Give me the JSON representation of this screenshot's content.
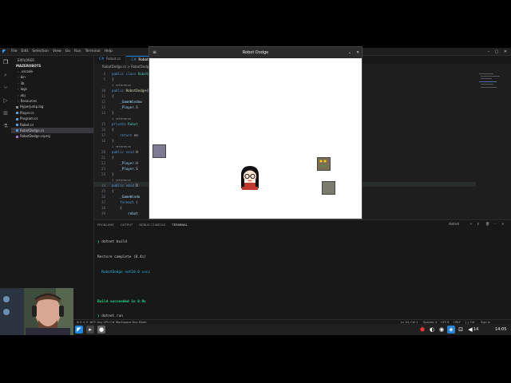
{
  "titlebar": {
    "menu": [
      "File",
      "Edit",
      "Selection",
      "View",
      "Go",
      "Run",
      "Terminal",
      "Help"
    ],
    "search": "MazeRobots",
    "update_label": "Update"
  },
  "explorer": {
    "header": "EXPLORER",
    "root": "MAZEROBOTS",
    "folders": [
      ".vscode",
      "bin",
      "lib",
      "logs",
      "obj",
      "Resources"
    ],
    "files": [
      "Hyperjump.log",
      "Player.cs",
      "Program.cs",
      "Robot.cs",
      "RobotDodge.cs",
      "RobotDodge.csproj"
    ],
    "active_file": "RobotDodge.cs",
    "outline_label": "OUTLINE",
    "timeline_label": "TIMELINE"
  },
  "tabs": [
    {
      "label": "Robot.cs",
      "active": false
    },
    {
      "label": "RobotDodge.cs",
      "active": true
    },
    {
      "label": "Player.cs",
      "active": false
    }
  ],
  "breadcrumb": "RobotDodge.cs > RobotDodge",
  "code": [
    {
      "ln": "4",
      "parts": [
        [
          "kw",
          "public class "
        ],
        [
          "ty",
          "RobotDodge"
        ]
      ]
    },
    {
      "ln": "5",
      "parts": [
        [
          "",
          "{"
        ]
      ]
    },
    {
      "ln": "",
      "parts": [
        [
          "ref",
          "1 reference"
        ]
      ]
    },
    {
      "ln": "10",
      "parts": [
        [
          "kw",
          "public "
        ],
        [
          "fn",
          "RobotDodge"
        ],
        [
          "",
          "(Window gameWindow)"
        ]
      ]
    },
    {
      "ln": "11",
      "parts": [
        [
          "",
          "{"
        ]
      ]
    },
    {
      "ln": "12",
      "parts": [
        [
          "va",
          "    _GameWindow"
        ]
      ]
    },
    {
      "ln": "13",
      "parts": [
        [
          "va",
          "    _Player"
        ],
        [
          "",
          ".S"
        ]
      ]
    },
    {
      "ln": "14",
      "parts": [
        [
          "",
          "}"
        ]
      ]
    },
    {
      "ln": "",
      "parts": [
        [
          "ref",
          "1 reference"
        ]
      ]
    },
    {
      "ln": "15",
      "parts": [
        [
          "kw",
          "private "
        ],
        [
          "ty",
          "Robot"
        ]
      ]
    },
    {
      "ln": "16",
      "parts": [
        [
          "",
          "{"
        ]
      ]
    },
    {
      "ln": "17",
      "parts": [
        [
          "kw",
          "    return "
        ],
        [
          "",
          "ne"
        ]
      ]
    },
    {
      "ln": "18",
      "parts": [
        [
          "",
          "}"
        ]
      ]
    },
    {
      "ln": "",
      "parts": [
        [
          "ref",
          "1 reference"
        ]
      ]
    },
    {
      "ln": "20",
      "parts": [
        [
          "kw",
          "public void "
        ],
        [
          "fn",
          "H"
        ]
      ]
    },
    {
      "ln": "21",
      "parts": [
        [
          "",
          "{"
        ]
      ]
    },
    {
      "ln": "22",
      "parts": [
        [
          "va",
          "    _Player"
        ],
        [
          "",
          ".H"
        ]
      ]
    },
    {
      "ln": "23",
      "parts": [
        [
          "va",
          "    _Player"
        ],
        [
          "",
          ".S"
        ]
      ]
    },
    {
      "ln": "24",
      "parts": [
        [
          "",
          "}"
        ]
      ]
    },
    {
      "ln": "",
      "parts": [
        [
          "ref",
          "1 reference"
        ]
      ]
    },
    {
      "ln": "34",
      "parts": [
        [
          "kw",
          "public void "
        ],
        [
          "fn",
          "D"
        ]
      ]
    },
    {
      "ln": "35",
      "parts": [
        [
          "",
          "{"
        ]
      ]
    },
    {
      "ln": "36",
      "parts": [
        [
          "va",
          "    _GameWindo"
        ]
      ]
    },
    {
      "ln": "37",
      "parts": [
        [
          "kw",
          "    foreach "
        ],
        [
          "",
          "("
        ]
      ]
    },
    {
      "ln": "38",
      "parts": [
        [
          "",
          "    {"
        ]
      ]
    },
    {
      "ln": "39",
      "parts": [
        [
          "va",
          "        robot"
        ]
      ]
    }
  ],
  "panel": {
    "tabs": [
      "PROBLEMS",
      "OUTPUT",
      "DEBUG CONSOLE",
      "TERMINAL"
    ],
    "terminal_name": "dotnet",
    "terminal": [
      {
        "prompt": "❯",
        "text": " dotnet build"
      },
      {
        "prompt": "",
        "text": "Restore complete (0.4s)"
      },
      {
        "prompt": "",
        "text": "  RobotDodge net10.0 succ"
      },
      {
        "prompt": "",
        "text": ""
      },
      {
        "prompt": "",
        "text": "Build succeeded in 0.9s"
      },
      {
        "prompt": "❯",
        "text": " dotnet run"
      },
      {
        "prompt": "",
        "text": "▯"
      }
    ]
  },
  "statusbar": {
    "left": "⊗ 0 ⚠ 0   .NET: Any CPU   C# Workspace Dev Mode",
    "right": [
      "Ln 34, Col 1",
      "Spaces: 4",
      "UTF-8",
      "CRLF",
      "{ } C#",
      "Sign In"
    ]
  },
  "game_window": {
    "title": "Robot Dodge",
    "menu_icon": "≡",
    "collapse_icon": "⌄",
    "close_icon": "✕",
    "robot_colors": [
      "#7f7a94",
      "#7a6e56",
      "#7b7a6e"
    ],
    "player": "player-sprite"
  },
  "taskbar": {
    "time": "14:05",
    "volume": "14"
  }
}
